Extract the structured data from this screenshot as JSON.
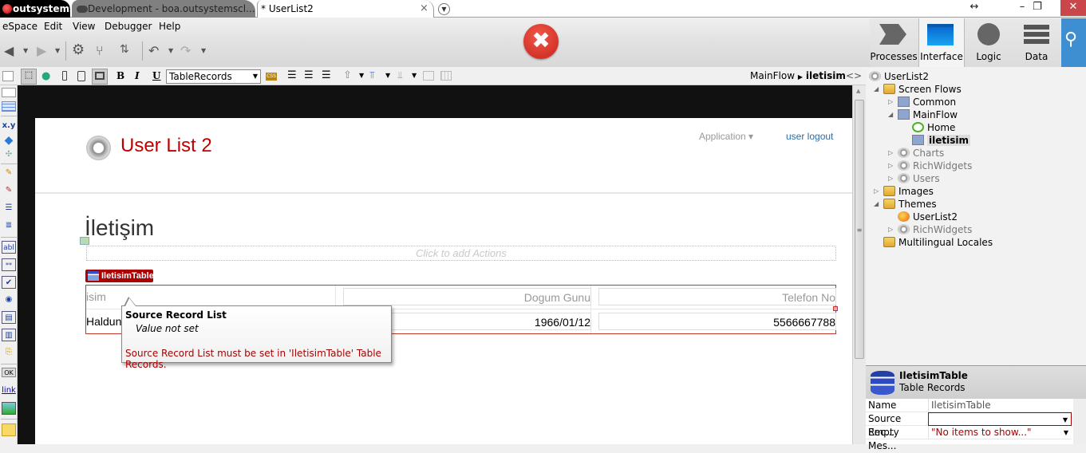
{
  "titlebar": {
    "brand": "outsystems",
    "tabs": [
      {
        "label": "Development - boa.outsystemscl..."
      },
      {
        "label": "* UserList2"
      }
    ],
    "close_tab": "×",
    "window_buttons": {
      "resize": "↔",
      "minimize": "–",
      "restore": "❐",
      "close": "✕"
    }
  },
  "menu": [
    "eSpace",
    "Edit",
    "View",
    "Debugger",
    "Help"
  ],
  "toolbar": {
    "error_symbol": "✖"
  },
  "nav_tabs": [
    {
      "label": "Processes"
    },
    {
      "label": "Interface",
      "active": true
    },
    {
      "label": "Logic"
    },
    {
      "label": "Data"
    }
  ],
  "design_toolbar": {
    "widget_select": "TableRecords",
    "css_label": "CSS",
    "breadcrumb_parent": "MainFlow",
    "breadcrumb_current": "iletisim",
    "code_toggle": "<>"
  },
  "palette": {
    "items": [
      "container",
      "table",
      "x.y",
      "if",
      "placeholder",
      "edit",
      "editrecord",
      "tablerecords",
      "listrecords",
      "abl",
      "***",
      "checkbox",
      "radio",
      "combo",
      "list",
      "upload",
      "OK",
      "link",
      "image",
      "note"
    ]
  },
  "canvas": {
    "app_title": "User List 2",
    "app_menu": "Application ▾",
    "logout": "user logout",
    "page_heading": "İletişim",
    "actions_placeholder": "Click to add Actions",
    "table_badge": "IletisimTable",
    "table": {
      "headers": [
        "isim",
        "Dogum Gunu",
        "Telefon No"
      ],
      "rows": [
        [
          "Haldun",
          "1966/01/12",
          "5566667788"
        ]
      ]
    }
  },
  "tooltip": {
    "title": "Source Record List",
    "value": "Value not set",
    "error": "Source Record List must be set in 'IletisimTable' Table Records."
  },
  "tree": {
    "root": "UserList2",
    "screen_flows": "Screen Flows",
    "common": "Common",
    "mainflow": "MainFlow",
    "home": "Home",
    "iletisim": "iletisim",
    "charts": "Charts",
    "richwidgets": "RichWidgets",
    "users": "Users",
    "images": "Images",
    "themes": "Themes",
    "theme_userlist2": "UserList2",
    "theme_richwidgets": "RichWidgets",
    "locales": "Multilingual Locales"
  },
  "properties": {
    "name": "IletisimTable",
    "type": "Table Records",
    "rows": [
      {
        "key": "Name",
        "value": "IletisimTable"
      },
      {
        "key": "Source Rec...",
        "value": ""
      },
      {
        "key": "Empty Mes...",
        "value": "\"No items to show...\""
      }
    ]
  }
}
